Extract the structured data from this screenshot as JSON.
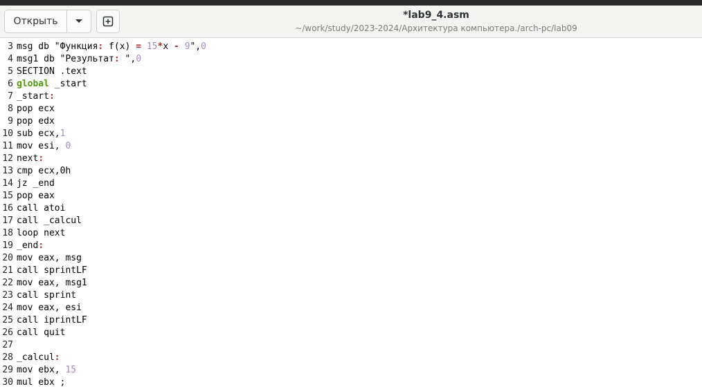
{
  "window": {
    "title": "*lab9_4.asm",
    "path": "~/work/study/2023-2024/Архитектура компьютера./arch-pc/lab09"
  },
  "toolbar": {
    "open_label": "Открыть",
    "dropdown_icon": "chevron-down-icon",
    "new_tab_icon": "new-tab-icon"
  },
  "colors": {
    "number": "#a38cc4",
    "keyword": "#4e9a06",
    "operator": "#a52a2a"
  },
  "editor": {
    "lines": [
      {
        "n": "3",
        "parts": [
          [
            "msg db \"Функция",
            ""
          ],
          [
            ":",
            "op"
          ],
          [
            " f(x) ",
            ""
          ],
          [
            "=",
            "op"
          ],
          [
            " ",
            ""
          ],
          [
            "15",
            "num"
          ],
          [
            "*",
            "op"
          ],
          [
            "x ",
            ""
          ],
          [
            "-",
            "op"
          ],
          [
            " ",
            ""
          ],
          [
            "9",
            "num"
          ],
          [
            "\",",
            ""
          ],
          [
            "0",
            "num"
          ]
        ]
      },
      {
        "n": "4",
        "parts": [
          [
            "msg1 db \"Результат",
            ""
          ],
          [
            ":",
            "op"
          ],
          [
            " \",",
            ""
          ],
          [
            "0",
            "num"
          ]
        ]
      },
      {
        "n": "5",
        "parts": [
          [
            "SECTION .text",
            ""
          ]
        ]
      },
      {
        "n": "6",
        "parts": [
          [
            "global",
            "kw"
          ],
          [
            " _start",
            ""
          ]
        ]
      },
      {
        "n": "7",
        "parts": [
          [
            "_start",
            ""
          ],
          [
            ":",
            "op"
          ]
        ]
      },
      {
        "n": "8",
        "parts": [
          [
            "pop ecx",
            ""
          ]
        ]
      },
      {
        "n": "9",
        "parts": [
          [
            "pop edx",
            ""
          ]
        ]
      },
      {
        "n": "10",
        "parts": [
          [
            "sub ecx,",
            ""
          ],
          [
            "1",
            "num"
          ]
        ]
      },
      {
        "n": "11",
        "parts": [
          [
            "mov esi, ",
            ""
          ],
          [
            "0",
            "num"
          ]
        ]
      },
      {
        "n": "12",
        "parts": [
          [
            "next",
            ""
          ],
          [
            ":",
            "op"
          ]
        ]
      },
      {
        "n": "13",
        "parts": [
          [
            "cmp ecx,0h",
            ""
          ]
        ]
      },
      {
        "n": "14",
        "parts": [
          [
            "jz _end",
            ""
          ]
        ]
      },
      {
        "n": "15",
        "parts": [
          [
            "pop eax",
            ""
          ]
        ]
      },
      {
        "n": "16",
        "parts": [
          [
            "call atoi",
            ""
          ]
        ]
      },
      {
        "n": "17",
        "parts": [
          [
            "call _calcul",
            ""
          ]
        ]
      },
      {
        "n": "18",
        "parts": [
          [
            "loop next",
            ""
          ]
        ]
      },
      {
        "n": "19",
        "parts": [
          [
            "_end",
            ""
          ],
          [
            ":",
            "op"
          ]
        ]
      },
      {
        "n": "20",
        "parts": [
          [
            "mov eax, msg",
            ""
          ]
        ]
      },
      {
        "n": "21",
        "parts": [
          [
            "call sprintLF",
            ""
          ]
        ]
      },
      {
        "n": "22",
        "parts": [
          [
            "mov eax, msg1",
            ""
          ]
        ]
      },
      {
        "n": "23",
        "parts": [
          [
            "call sprint",
            ""
          ]
        ]
      },
      {
        "n": "24",
        "parts": [
          [
            "mov eax, esi",
            ""
          ]
        ]
      },
      {
        "n": "25",
        "parts": [
          [
            "call iprintLF",
            ""
          ]
        ]
      },
      {
        "n": "26",
        "parts": [
          [
            "call quit",
            ""
          ]
        ]
      },
      {
        "n": "27",
        "parts": []
      },
      {
        "n": "28",
        "parts": [
          [
            "_calcul",
            ""
          ],
          [
            ":",
            "op"
          ]
        ]
      },
      {
        "n": "29",
        "parts": [
          [
            "mov ebx, ",
            ""
          ],
          [
            "15",
            "num"
          ]
        ]
      },
      {
        "n": "30",
        "parts": [
          [
            "mul ebx ;",
            ""
          ]
        ]
      }
    ]
  }
}
